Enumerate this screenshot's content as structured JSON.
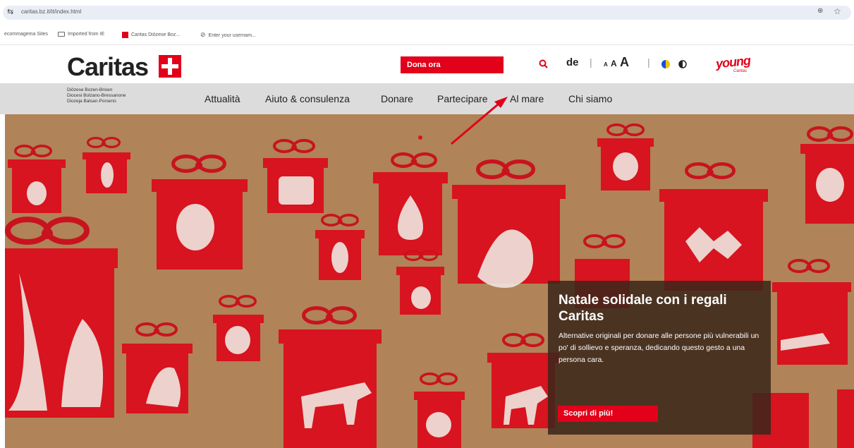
{
  "browser": {
    "url": "caritas.bz.it/it/index.html",
    "bookmarks": [
      "ecommagema Sites",
      "Imported from IE",
      "Caritas Diözese Boz...",
      "Enter your usernam..."
    ],
    "icons": [
      "tune-icon",
      "zoom-icon",
      "star-icon"
    ]
  },
  "header": {
    "logo": "Caritas",
    "donate": "Dona ora",
    "lang": "de",
    "font_sizes": [
      "A",
      "A",
      "A"
    ],
    "young": "young",
    "young_sub": "Caritas"
  },
  "nav": {
    "diocese": [
      "Diözese Bozen-Brixen",
      "Diocesi Bolzano-Bressanone",
      "Diozeja Balsan-Porsenù"
    ],
    "items": [
      "Attualità",
      "Aiuto & consulenza",
      "Donare",
      "Partecipare",
      "Al mare",
      "Chi siamo"
    ]
  },
  "promo": {
    "title": "Natale solidale con i regali Caritas",
    "body": "Alternative originali per donare alle persone più vulnerabili un po' di sollievo e speranza, dedicando questo gesto a una persona cara.",
    "cta": "Scopri di più!"
  },
  "colors": {
    "brand_red": "#e2001a",
    "hero_bg": "#b08358",
    "nav_bg": "#dcdcdc"
  }
}
